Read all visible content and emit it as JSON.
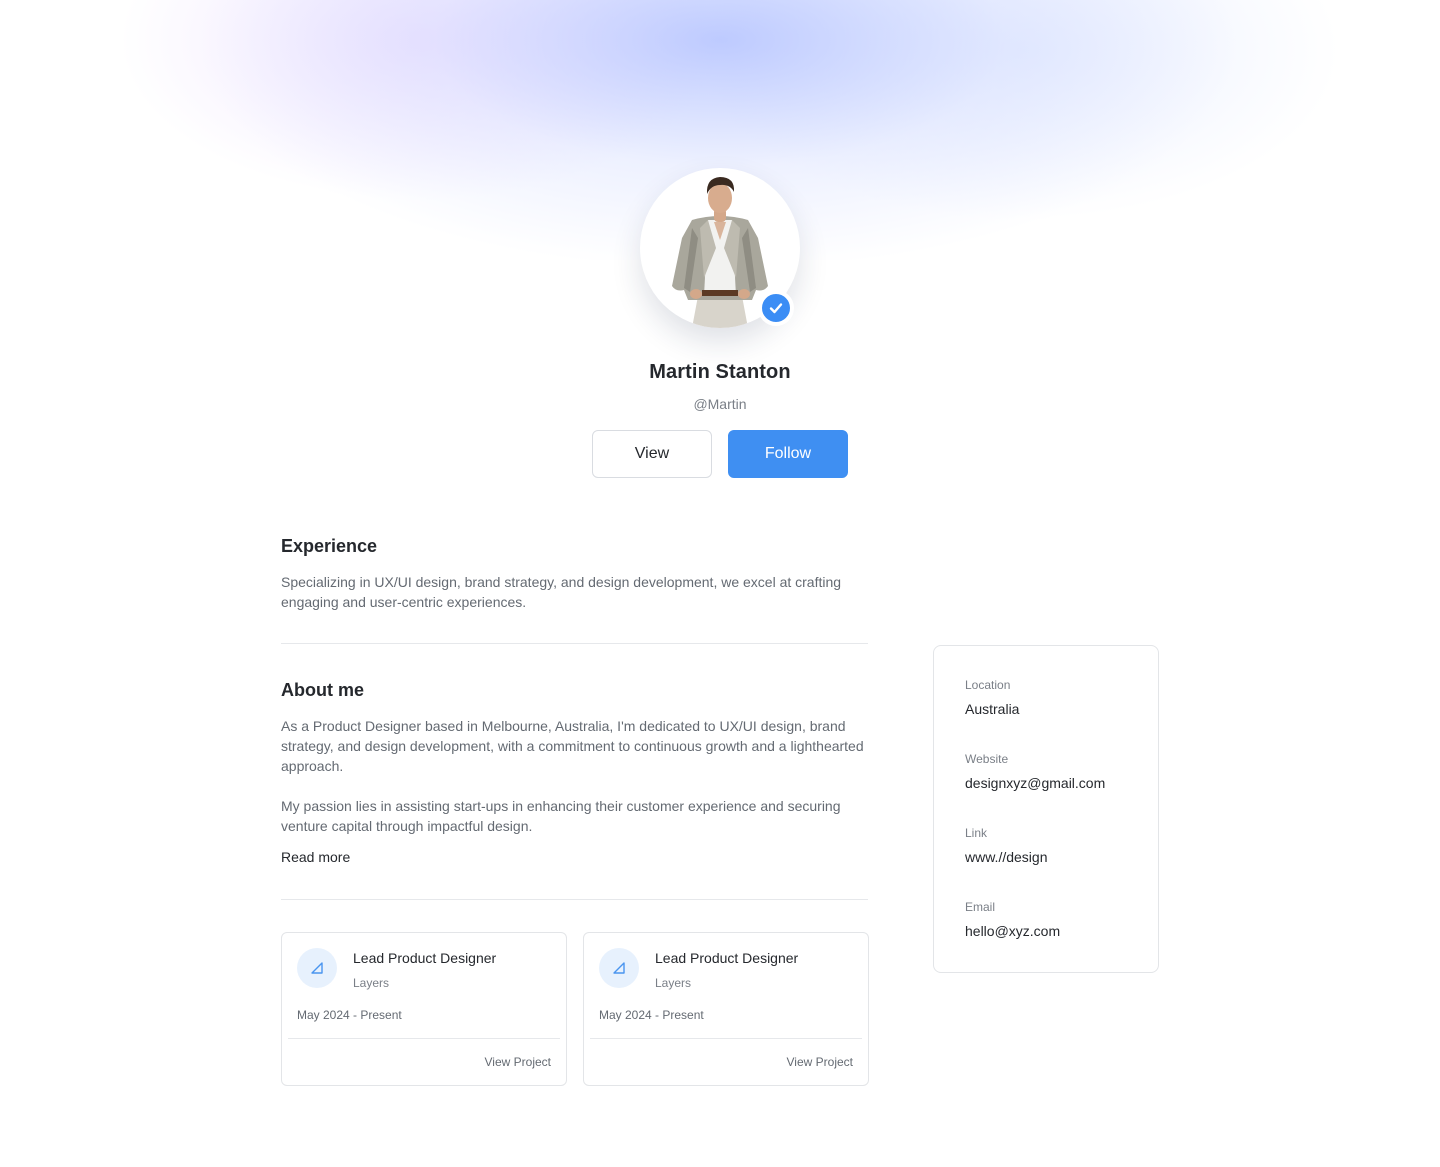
{
  "profile": {
    "name": "Martin Stanton",
    "handle": "@Martin",
    "verified": true
  },
  "actions": {
    "view_label": "View",
    "follow_label": "Follow"
  },
  "experience": {
    "title": "Experience",
    "text": "Specializing in UX/UI design, brand strategy, and design development, we excel at crafting engaging and user-centric experiences."
  },
  "about": {
    "title": "About me",
    "paragraph1": "As a Product Designer based in Melbourne, Australia, I'm dedicated to UX/UI design, brand strategy, and design development, with a commitment to continuous growth and a lighthearted approach.",
    "paragraph2": "My passion lies in assisting start-ups in enhancing their customer experience and securing venture capital through impactful design.",
    "read_more": "Read more"
  },
  "jobs": [
    {
      "role": "Lead Product Designer",
      "company": "Layers",
      "dates": "May 2024 - Present",
      "link": "View Project",
      "icon": "layers-icon"
    },
    {
      "role": "Lead Product Designer",
      "company": "Layers",
      "dates": "May 2024 - Present",
      "link": "View Project",
      "icon": "layers-icon"
    }
  ],
  "info": {
    "location_label": "Location",
    "location_value": "Australia",
    "website_label": "Website",
    "website_value": "designxyz@gmail.com",
    "link_label": "Link",
    "link_value": "www.//design",
    "email_label": "Email",
    "email_value": "hello@xyz.com"
  },
  "colors": {
    "accent": "#3f8ff2",
    "verified": "#3b8df5",
    "text_primary": "#25282d",
    "text_secondary": "#646a72"
  }
}
